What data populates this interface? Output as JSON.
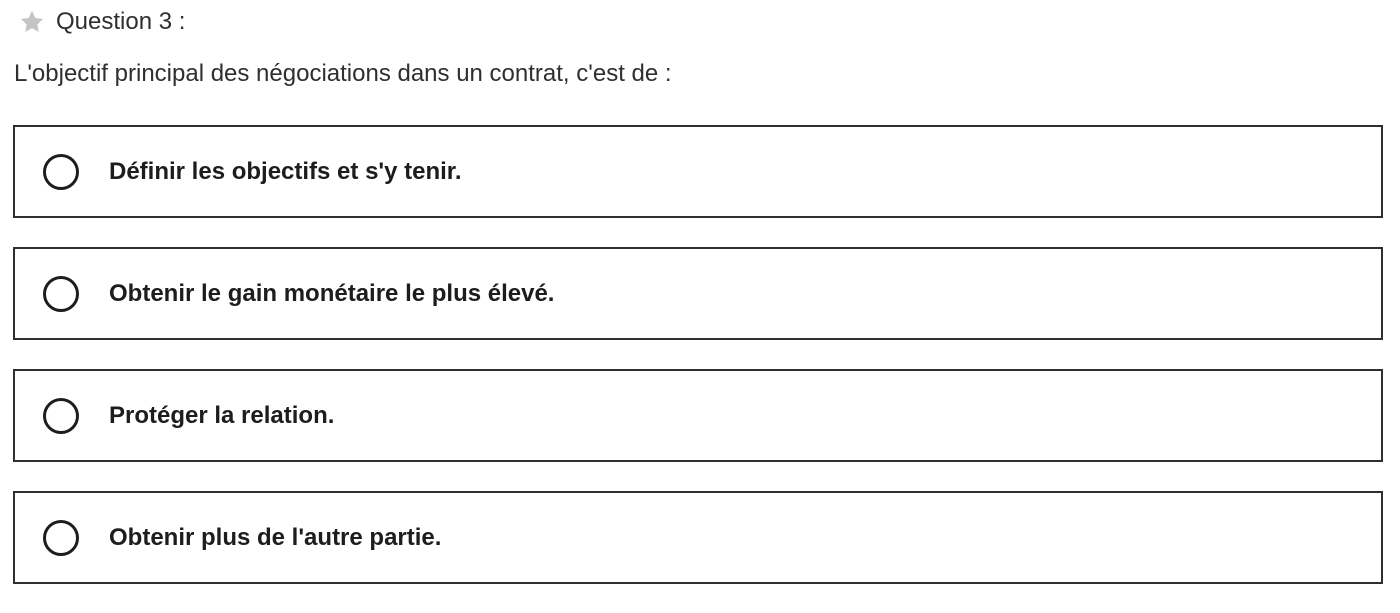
{
  "question": {
    "header": "Question 3 :",
    "prompt": "L'objectif principal des négociations dans un contrat, c'est de :",
    "star_icon": "star-icon",
    "star_color": "#c4c4c4"
  },
  "options": [
    {
      "label": "Définir les objectifs et s'y tenir."
    },
    {
      "label": "Obtenir le gain monétaire le plus élevé."
    },
    {
      "label": "Protéger la relation."
    },
    {
      "label": "Obtenir plus de l'autre partie."
    }
  ]
}
